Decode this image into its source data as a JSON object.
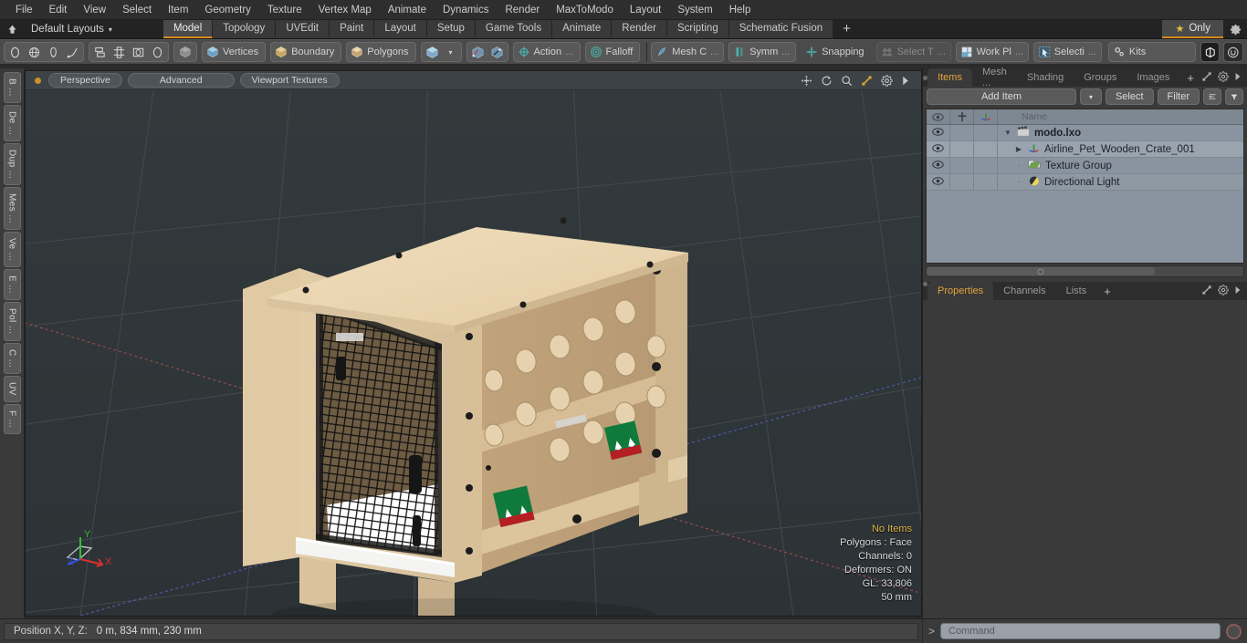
{
  "menubar": {
    "items": [
      "File",
      "Edit",
      "View",
      "Select",
      "Item",
      "Geometry",
      "Texture",
      "Vertex Map",
      "Animate",
      "Dynamics",
      "Render",
      "MaxToModo",
      "Layout",
      "System",
      "Help"
    ]
  },
  "layout_row": {
    "home_icon": "home-icon",
    "layout_name": "Default Layouts",
    "caret": "▾",
    "tabs": [
      {
        "label": "Model",
        "selected": true
      },
      {
        "label": "Topology",
        "selected": false
      },
      {
        "label": "UVEdit",
        "selected": false
      },
      {
        "label": "Paint",
        "selected": false
      },
      {
        "label": "Layout",
        "selected": false
      },
      {
        "label": "Setup",
        "selected": false
      },
      {
        "label": "Game Tools",
        "selected": false
      },
      {
        "label": "Animate",
        "selected": false
      },
      {
        "label": "Render",
        "selected": false
      },
      {
        "label": "Scripting",
        "selected": false
      },
      {
        "label": "Schematic Fusion",
        "selected": false
      }
    ],
    "add_tab": "+",
    "only_tab": {
      "label": "Only",
      "star": "★"
    },
    "gear_icon": "gear-icon"
  },
  "toolbar": {
    "shape_group": [
      "circle-icon",
      "globe-icon",
      "pen-icon",
      "curve-icon"
    ],
    "transform_group": [
      "mirror-icon",
      "align-icon",
      "bevel-icon",
      "ellipse-icon"
    ],
    "cube_icon": "cube-icon",
    "selection_modes": [
      {
        "label": "Vertices",
        "icon": "vertices-icon"
      },
      {
        "label": "Boundary",
        "icon": "boundary-icon"
      },
      {
        "label": "Polygons",
        "icon": "polygons-icon"
      }
    ],
    "item_mode_icon": "item-cube-icon",
    "dropdown_caret": "▾",
    "snap_icons": [
      "snap-vert-icon",
      "snap-elem-icon"
    ],
    "action_center": {
      "label": "Action",
      "suffix": "...",
      "icon": "action-center-icon"
    },
    "falloff": {
      "label": "Falloff",
      "icon": "falloff-icon"
    },
    "mesh_constraint": {
      "label": "Mesh C",
      "suffix": "...",
      "icon": "mesh-constraint-icon"
    },
    "symmetry": {
      "label": "Symm",
      "suffix": "...",
      "icon": "symmetry-icon"
    },
    "snapping": {
      "label": "Snapping",
      "icon": "snapping-icon"
    },
    "select_through": {
      "label": "Select T",
      "suffix": "...",
      "icon": "select-through-icon",
      "disabled": true
    },
    "work_plane": {
      "label": "Work Pl",
      "suffix": "...",
      "icon": "work-plane-icon"
    },
    "selection_sets": {
      "label": "Selecti",
      "suffix": "...",
      "icon": "selection-icon"
    },
    "kits": {
      "label": "Kits",
      "icon": "kits-icon"
    },
    "app_icons": [
      "modo-icon",
      "unreal-icon"
    ]
  },
  "vertical_tabs": [
    "B ...",
    "De ...",
    "Dup ...",
    "Mes ...",
    "Ve ...",
    "E ...",
    "Pol ...",
    "C ...",
    "UV",
    "F ..."
  ],
  "viewport": {
    "dot": "active-dot",
    "pills": [
      "Perspective",
      "Advanced",
      "Viewport Textures"
    ],
    "nav_icons": [
      "pan-icon",
      "rotate-icon",
      "zoom-icon",
      "fit-icon",
      "viewport-gear-icon",
      "viewport-more-icon"
    ],
    "stats": {
      "selection": "No Items",
      "polygons": "Polygons : Face",
      "channels": "Channels: 0",
      "deformers": "Deformers: ON",
      "gl": "GL: 33,806",
      "grid": "50 mm"
    },
    "gizmo": {
      "x": "X",
      "y": "Y",
      "z": "Z"
    },
    "colors": {
      "background": "#2f3538",
      "grid": "#3e4548",
      "axis_x": "#8c4b4b",
      "axis_z": "#4a5591",
      "crate_light": "#e8d5b0",
      "crate_mid": "#c9ab82",
      "crate_dark": "#b09670",
      "mesh": "#141414"
    }
  },
  "right_panel": {
    "tabs": [
      {
        "label": "Items",
        "selected": true
      },
      {
        "label": "Mesh ...",
        "selected": false
      },
      {
        "label": "Shading",
        "selected": false
      },
      {
        "label": "Groups",
        "selected": false
      },
      {
        "label": "Images",
        "selected": false
      }
    ],
    "add_tab": "+",
    "tab_right_icons": [
      "expand-icon",
      "panel-gear-icon",
      "panel-more-icon"
    ],
    "add_item_button": "Add Item",
    "add_item_caret": "▾",
    "select_button": "Select",
    "filter_button": "Filter",
    "list_icon": "list-toggle-icon",
    "funnel_icon": "funnel-icon",
    "tree_headers": {
      "visibility": "eye-icon",
      "lock": "lock-icon",
      "transform": "axis-icon",
      "name": "Name"
    },
    "tree_rows": [
      {
        "name": "modo.lxo",
        "icon": "scene-icon",
        "depth": 0,
        "twirl": "▼",
        "bold": true,
        "selected": false
      },
      {
        "name": "Airline_Pet_Wooden_Crate_001",
        "icon": "mesh-item-icon",
        "depth": 1,
        "twirl": "▶",
        "bold": false,
        "selected": true
      },
      {
        "name": "Texture Group",
        "icon": "texture-group-icon",
        "depth": 1,
        "twirl": "",
        "bold": false,
        "selected": false
      },
      {
        "name": "Directional Light",
        "icon": "light-icon",
        "depth": 1,
        "twirl": "",
        "bold": false,
        "selected": false
      }
    ]
  },
  "properties_panel": {
    "tabs": [
      {
        "label": "Properties",
        "selected": true
      },
      {
        "label": "Channels",
        "selected": false
      },
      {
        "label": "Lists",
        "selected": false
      }
    ],
    "add_tab": "+",
    "right_icons": [
      "expand-icon",
      "props-gear-icon",
      "props-more-icon"
    ]
  },
  "status_bar": {
    "position_label": "Position X, Y, Z:",
    "position_value": "0 m, 834 mm, 230 mm",
    "command_prompt": ">",
    "command_placeholder": "Command",
    "record_icon": "record-icon"
  }
}
